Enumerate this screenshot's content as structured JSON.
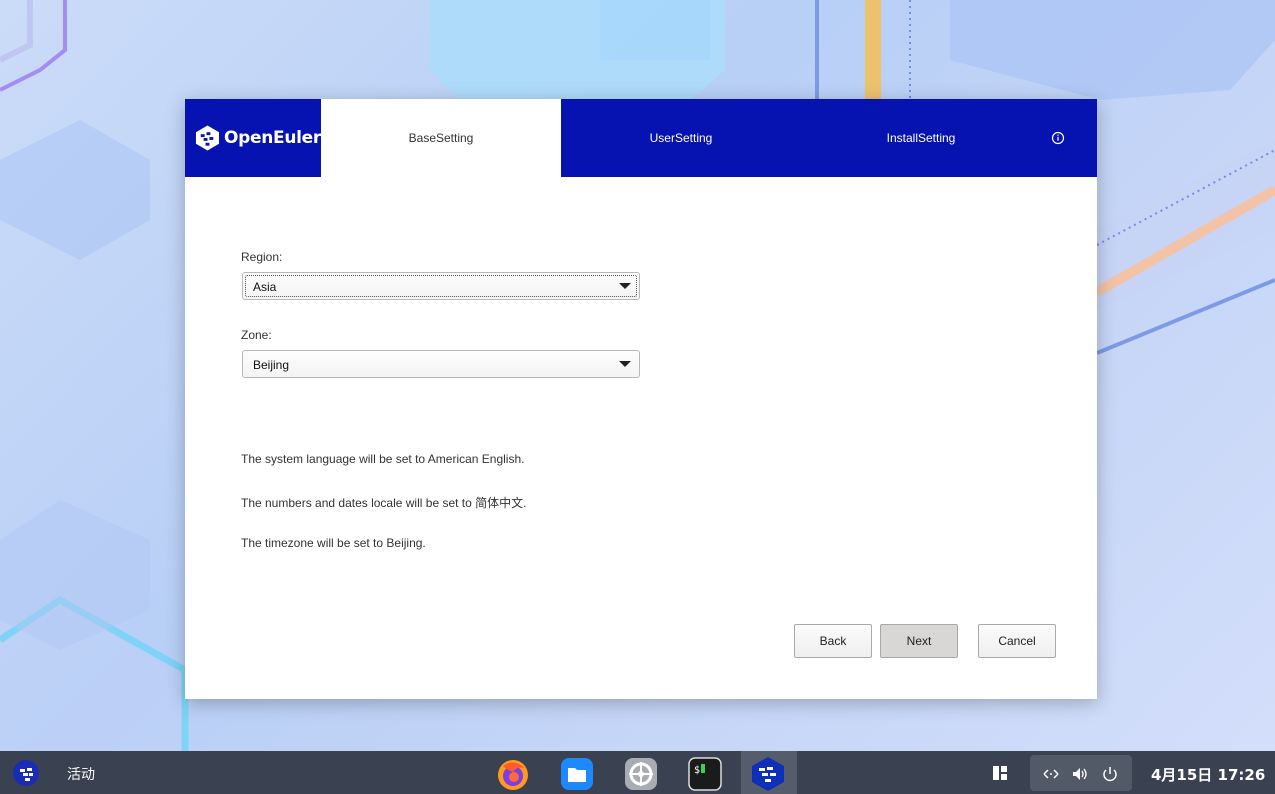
{
  "installer": {
    "brand": "OpenEuler",
    "tabs": [
      {
        "label": "BaseSetting",
        "active": true
      },
      {
        "label": "UserSetting",
        "active": false
      },
      {
        "label": "InstallSetting",
        "active": false
      }
    ],
    "info_icon": "info-circle-icon",
    "region": {
      "label": "Region:",
      "value": "Asia"
    },
    "zone": {
      "label": "Zone:",
      "value": "Beijing"
    },
    "messages": [
      "The system language will be set to American English.",
      "The numbers and dates locale will be set to 简体中文.",
      "The timezone will be set to Beijing."
    ],
    "buttons": {
      "back": "Back",
      "next": "Next",
      "cancel": "Cancel"
    },
    "colors": {
      "header": "#0613b1"
    }
  },
  "taskbar": {
    "activities": "活动",
    "clock": "4月15日 17:26",
    "dock": [
      "firefox-icon",
      "files-icon",
      "settings-icon",
      "terminal-icon",
      "openeuler-installer-icon"
    ],
    "tray": [
      "network-icon",
      "volume-icon",
      "power-icon"
    ]
  }
}
